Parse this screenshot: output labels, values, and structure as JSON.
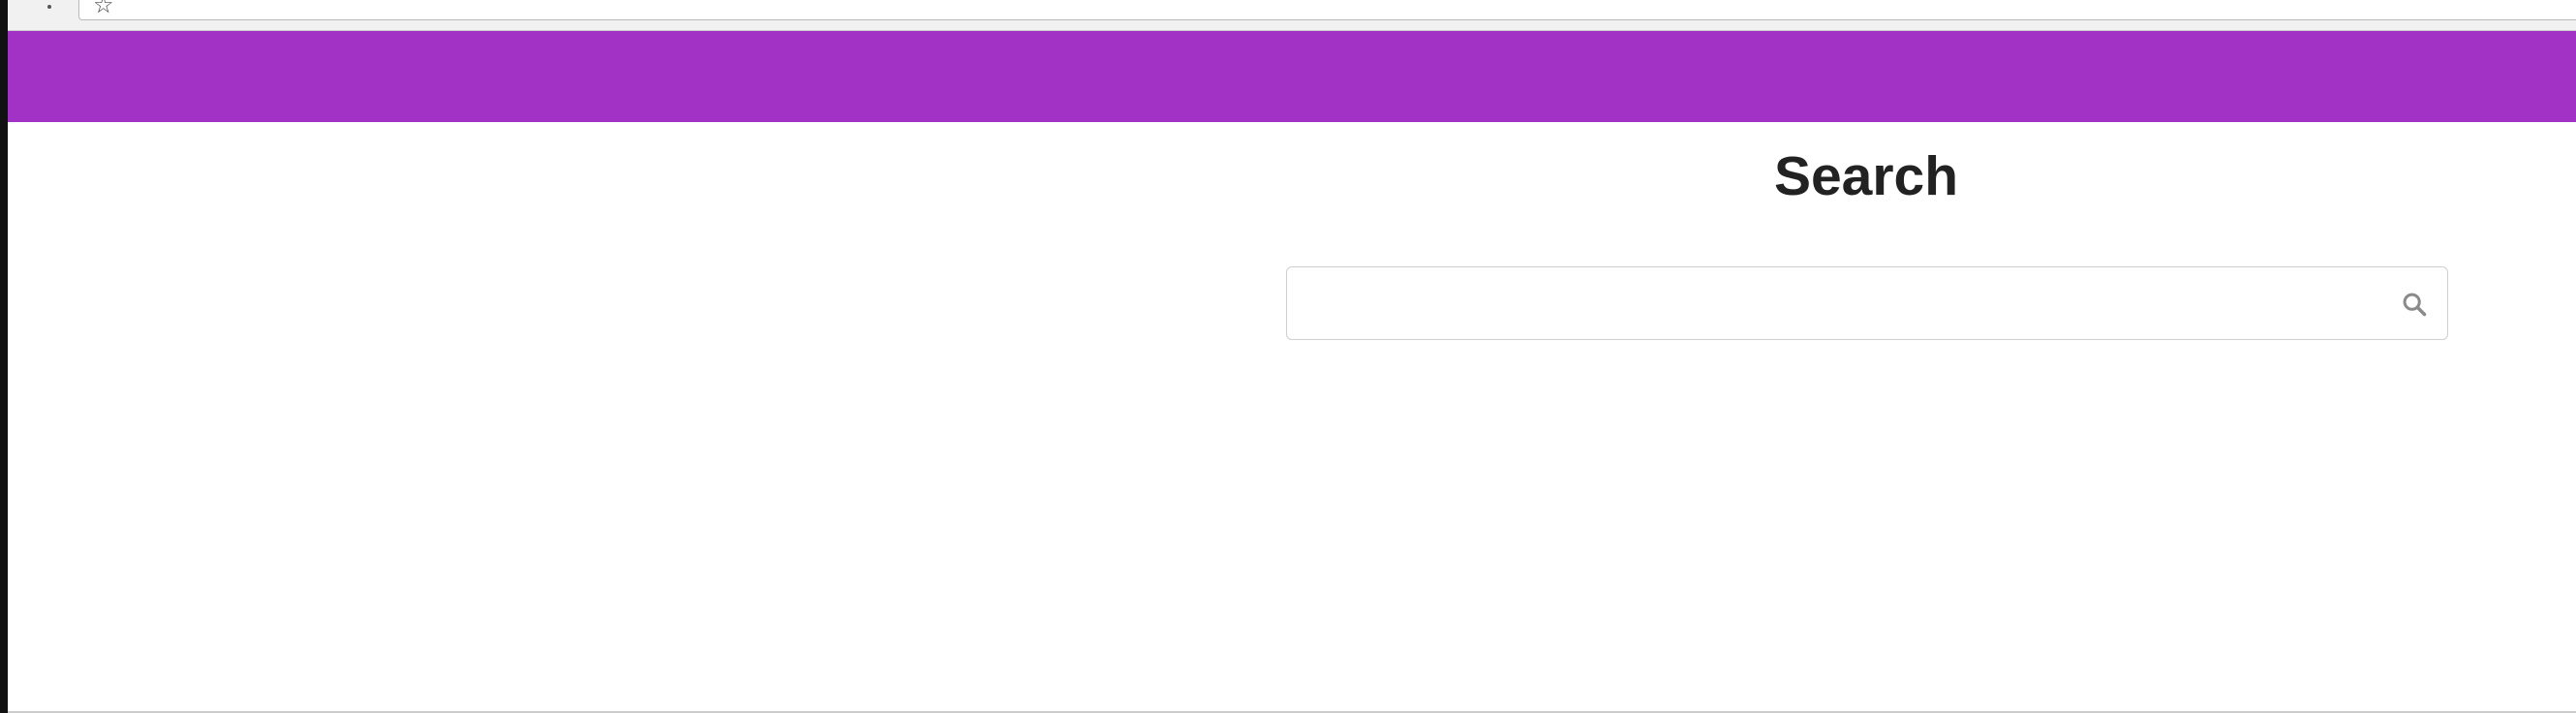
{
  "browser": {
    "bookmark_icon": "star-icon"
  },
  "header": {
    "band_color": "#a232c6"
  },
  "main": {
    "title": "Search",
    "search": {
      "value": "",
      "placeholder": "",
      "icon": "search-icon"
    }
  }
}
